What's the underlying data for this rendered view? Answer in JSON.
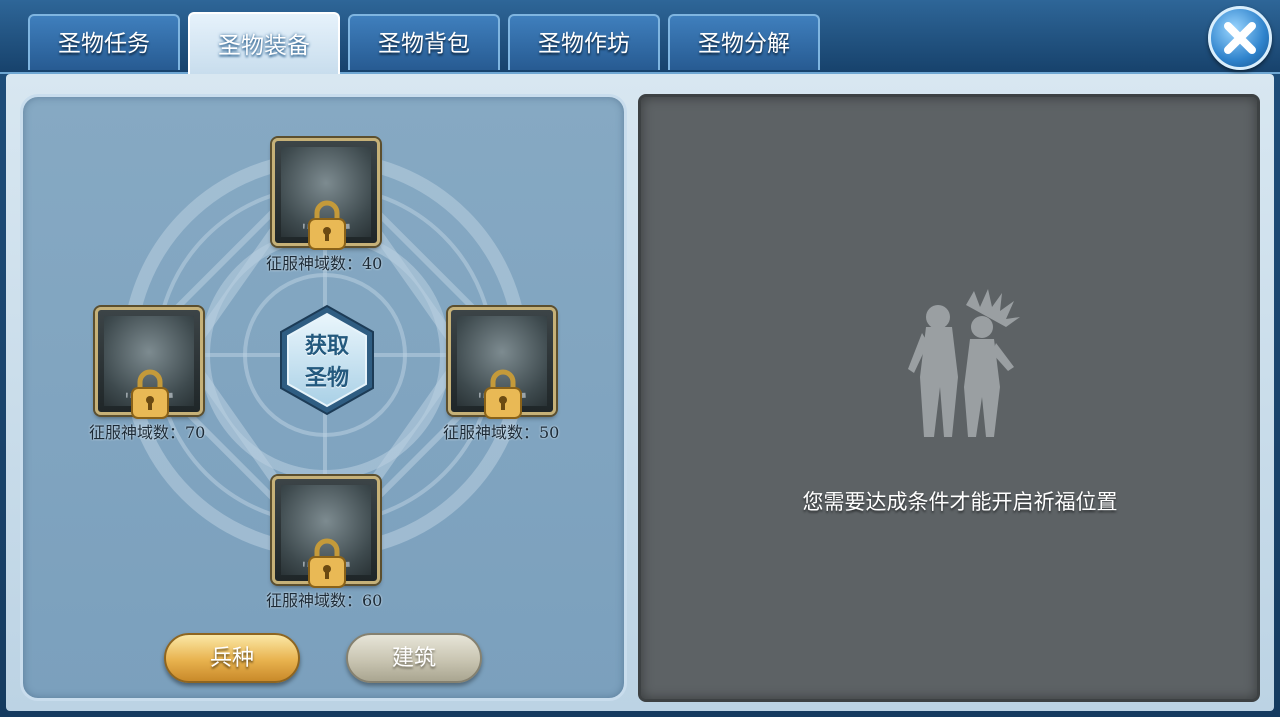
{
  "tabs": [
    {
      "label": "圣物任务",
      "active": false
    },
    {
      "label": "圣物装备",
      "active": true
    },
    {
      "label": "圣物背包",
      "active": false
    },
    {
      "label": "圣物作坊",
      "active": false
    },
    {
      "label": "圣物分解",
      "active": false
    }
  ],
  "close_icon": "close-x-icon",
  "slots": [
    {
      "position": "top",
      "label": "征服神域数：40",
      "locked": true
    },
    {
      "position": "left",
      "label": "征服神域数：70",
      "locked": true
    },
    {
      "position": "right",
      "label": "征服神域数：50",
      "locked": true
    },
    {
      "position": "bottom",
      "label": "征服神域数：60",
      "locked": true
    }
  ],
  "center_button": {
    "line1": "获取",
    "line2": "圣物"
  },
  "buttons": {
    "troops": "兵种",
    "building": "建筑"
  },
  "right_panel": {
    "message": "您需要达成条件才能开启祈福位置"
  },
  "colors": {
    "accent": "#2f83cc",
    "gold": "#e8b24e",
    "panel_dark": "#5d6265",
    "panel_light": "#86a9c3"
  }
}
